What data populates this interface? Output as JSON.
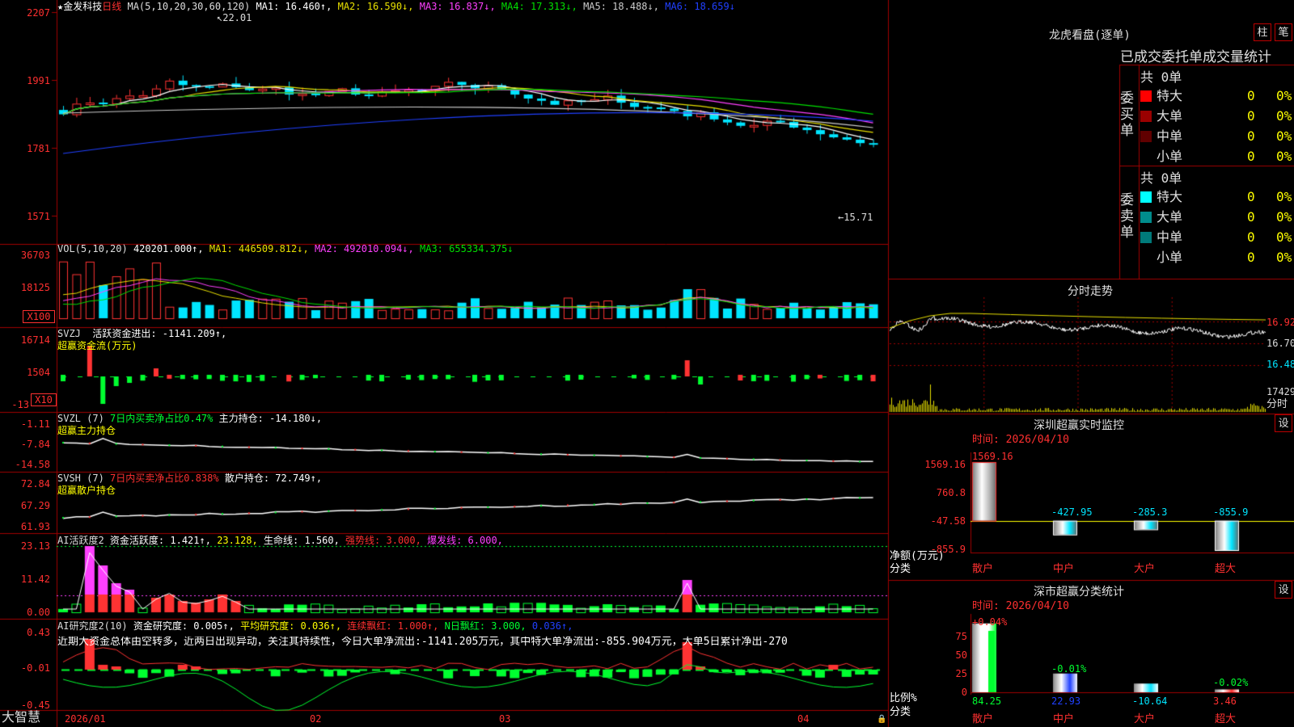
{
  "stock": {
    "name": "★金发科技",
    "period": "日线"
  },
  "colors": {
    "up": "#ff3333",
    "down": "#00e5ff",
    "grid": "#a00000",
    "ma1": "#ffffff",
    "ma2": "#e8e000",
    "ma3": "#ff40ff",
    "ma4": "#00e000",
    "ma5": "#cccccc",
    "ma6": "#2040ff",
    "green": "#00ff30",
    "magenta": "#ff40ff",
    "yellow": "#ffff00"
  },
  "main": {
    "ma_title": "MA(5,10,20,30,60,120)",
    "ma1": "MA1: 16.460↑,",
    "ma2": "MA2: 16.590↓,",
    "ma3": "MA3: 16.837↓,",
    "ma4": "MA4: 17.313↓,",
    "ma5": "MA5: 18.488↓,",
    "ma6": "MA6: 18.659↓",
    "high_note": "22.01",
    "low_note": "15.71",
    "y_labels": [
      "2207",
      "1991",
      "1781",
      "1571"
    ]
  },
  "vol": {
    "title": "VOL(5,10,20)",
    "value": "420201.000↑,",
    "ma1": "MA1: 446509.812↓,",
    "ma2": "MA2: 492010.094↓,",
    "ma3": "MA3: 655334.375↓",
    "y_labels": [
      "36703",
      "18125"
    ],
    "unit": "X100"
  },
  "svzj": {
    "title": "SVZJ",
    "label": "活跃资金进出: -1141.209↑,",
    "sub": "超赢资金流(万元)",
    "y_labels": [
      "16714",
      "1504",
      "-13"
    ],
    "unit": "X10"
  },
  "svzl": {
    "title": "SVZL (7)",
    "label1": "7日内买卖净占比0.47%",
    "label2": "主力持仓: -14.180↓,",
    "sub": "超赢主力持仓",
    "y_labels": [
      "-1.11",
      "-7.84",
      "-14.58"
    ]
  },
  "svsh": {
    "title": "SVSH (7)",
    "label1": "7日内买卖净占比0.838%",
    "label2": "散户持仓: 72.749↑,",
    "sub": "超赢散户持仓",
    "y_labels": [
      "72.84",
      "67.29",
      "61.93"
    ]
  },
  "ai2": {
    "title": "AI活跃度2",
    "label1": "资金活跃度: 1.421↑,",
    "label2": "23.128,",
    "label3": "生命线: 1.560,",
    "label4": "强势线: 3.000,",
    "label5": "爆发线: 6.000,",
    "y_labels": [
      "23.13",
      "11.42",
      "0.00"
    ]
  },
  "ai_research": {
    "title": "AI研究度2(10)",
    "label1": "资金研究度: 0.005↑,",
    "label2": "平均研究度: 0.036↑,",
    "label3": "连续飘红: 1.000↑,",
    "label4": "N日飘红: 3.000,",
    "label5": "0.036↑,",
    "comment": "近期大资金总体由空转多，近两日出现异动，关注其持续性，今日大单净流出:-1141.205万元，其中特大单净流出:-855.904万元，大单5日累计净出-270",
    "y_labels": [
      "0.43",
      "-0.01",
      "-0.45"
    ]
  },
  "xaxis": {
    "brand": "大智慧",
    "labels": [
      "2026/01",
      "02",
      "03",
      "04"
    ]
  },
  "longhu": {
    "title": "龙虎看盘(逐单)",
    "btn1": "柱",
    "btn2": "笔",
    "header": "已成交委托单成交量统计",
    "buy": {
      "total": "共 0单",
      "side": "委买单",
      "rows": [
        {
          "name": "特大",
          "v": "0",
          "p": "0%"
        },
        {
          "name": "大单",
          "v": "0",
          "p": "0%"
        },
        {
          "name": "中单",
          "v": "0",
          "p": "0%"
        },
        {
          "name": "小单",
          "v": "0",
          "p": "0%"
        }
      ]
    },
    "sell": {
      "total": "共 0单",
      "side": "委卖单",
      "rows": [
        {
          "name": "特大",
          "v": "0",
          "p": "0%"
        },
        {
          "name": "大单",
          "v": "0",
          "p": "0%"
        },
        {
          "name": "中单",
          "v": "0",
          "p": "0%"
        },
        {
          "name": "小单",
          "v": "0",
          "p": "0%"
        }
      ]
    }
  },
  "intraday": {
    "title": "分时走势",
    "y_labels": [
      "16.92",
      "16.70",
      "16.48"
    ],
    "vol_label": "17429",
    "footer": "分时"
  },
  "monitor": {
    "title": "深圳超赢实时监控",
    "btn": "设",
    "time": "时间: 2026/04/10",
    "top": "1569.16",
    "y_labels": [
      "1569.16",
      "760.8",
      "-47.58",
      "-855.9"
    ],
    "bars": [
      {
        "name": "散户",
        "value": "1569.16"
      },
      {
        "name": "中户",
        "value": "-427.95"
      },
      {
        "name": "大户",
        "value": "-285.3"
      },
      {
        "name": "超大",
        "value": "-855.9"
      }
    ],
    "axis_title": "净额(万元)",
    "axis_sub": "分类"
  },
  "classify": {
    "title": "深市超赢分类统计",
    "btn": "设",
    "time": "时间: 2026/04/10",
    "y_labels": [
      "75",
      "50",
      "25",
      "0"
    ],
    "bars": [
      {
        "name": "散户",
        "value": "84.25",
        "note": "+0.04%"
      },
      {
        "name": "中户",
        "value": "22.93",
        "note": "-0.01%"
      },
      {
        "name": "大户",
        "value": "-10.64",
        "note": ""
      },
      {
        "name": "超大",
        "value": "3.46",
        "note": "-0.02%"
      }
    ],
    "axis_title": "比例%",
    "axis_sub": "分类"
  }
}
